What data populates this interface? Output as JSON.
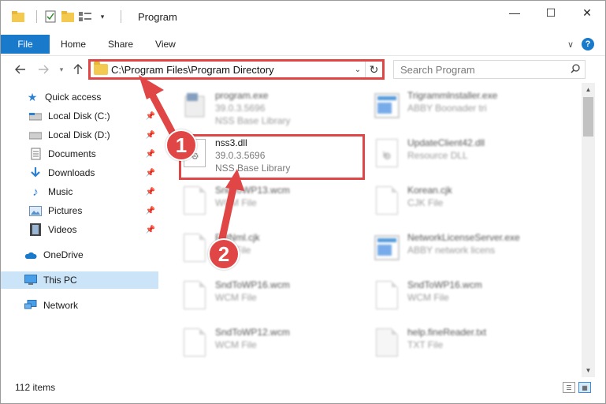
{
  "window": {
    "title": "Program",
    "minimize": "—",
    "maximize": "☐",
    "close": "✕"
  },
  "ribbon": {
    "tabs": [
      "File",
      "Home",
      "Share",
      "View"
    ],
    "help": "?",
    "expand": "∨"
  },
  "address": {
    "path": "C:\\Program Files\\Program Directory",
    "dropdown": "⌄",
    "refresh": "↻"
  },
  "search": {
    "placeholder": "Search Program"
  },
  "sidebar": {
    "items": [
      {
        "label": "Quick access",
        "icon": "star-icon"
      },
      {
        "label": "Local Disk (C:)",
        "icon": "drive-icon"
      },
      {
        "label": "Local Disk (D:)",
        "icon": "drive-icon"
      },
      {
        "label": "Documents",
        "icon": "documents-icon"
      },
      {
        "label": "Downloads",
        "icon": "downloads-icon"
      },
      {
        "label": "Music",
        "icon": "music-icon"
      },
      {
        "label": "Pictures",
        "icon": "pictures-icon"
      },
      {
        "label": "Videos",
        "icon": "videos-icon"
      },
      {
        "label": "OneDrive",
        "icon": "cloud-icon"
      },
      {
        "label": "This PC",
        "icon": "computer-icon"
      },
      {
        "label": "Network",
        "icon": "network-icon"
      }
    ]
  },
  "files": [
    {
      "name": "program.exe",
      "line2": "39.0.3.5696",
      "line3": "NSS Base Library",
      "icon": "exe-icon"
    },
    {
      "name": "Trigrammlnstaller.exe",
      "line2": "ABBY Boonader tri",
      "line3": "",
      "icon": "window-app-icon"
    },
    {
      "name": "nss3.dll",
      "line2": "39.0.3.5696",
      "line3": "NSS Base Library",
      "icon": "dll-icon"
    },
    {
      "name": "UpdateClient42.dll",
      "line2": "Resource DLL",
      "line3": "",
      "icon": "dll-icon"
    },
    {
      "name": "SndToWP13.wcm",
      "line2": "WCM File",
      "line3": "",
      "icon": "file-icon"
    },
    {
      "name": "Korean.cjk",
      "line2": "CJK File",
      "line3": "",
      "icon": "file-icon"
    },
    {
      "name": "FntNml.cjk",
      "line2": "CJK File",
      "line3": "",
      "icon": "file-icon"
    },
    {
      "name": "NetworkLicenseServer.exe",
      "line2": "ABBY network licens",
      "line3": "",
      "icon": "window-app-icon"
    },
    {
      "name": "SndToWP16.wcm",
      "line2": "WCM File",
      "line3": "",
      "icon": "file-icon"
    },
    {
      "name": "SndToWP16.wcm",
      "line2": "WCM File",
      "line3": "",
      "icon": "file-icon"
    },
    {
      "name": "SndToWP12.wcm",
      "line2": "WCM File",
      "line3": "",
      "icon": "file-icon"
    },
    {
      "name": "help.fineReader.txt",
      "line2": "TXT File",
      "line3": "",
      "icon": "txt-icon"
    }
  ],
  "status": {
    "count": "112 items"
  },
  "annotations": {
    "step1": "1",
    "step2": "2",
    "arrow_color": "#e04646"
  }
}
